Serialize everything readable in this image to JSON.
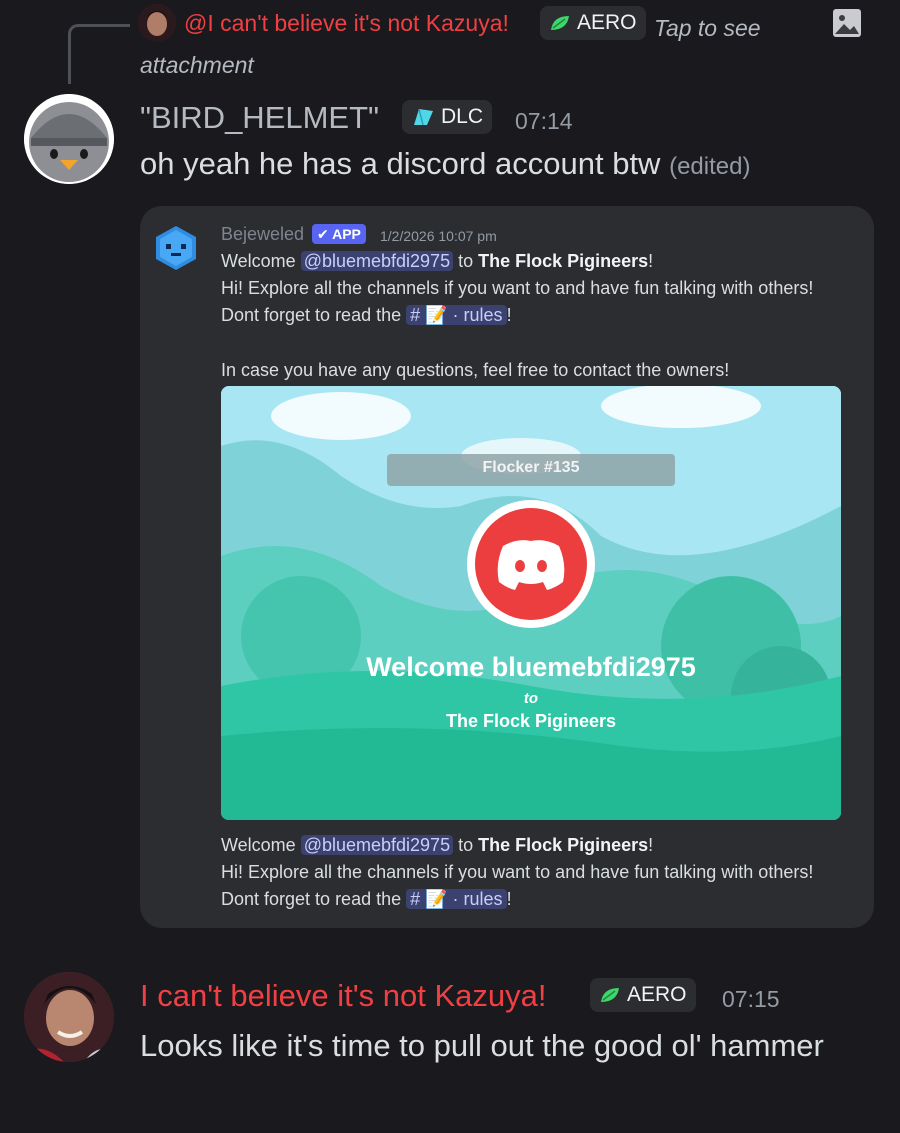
{
  "reply": {
    "author": "@I can't believe it's not Kazuya!",
    "tag": "AERO",
    "text": "Tap to see attachment",
    "icon": "image-icon"
  },
  "message1": {
    "author": "\"BIRD_HELMET\"",
    "tag": "DLC",
    "time": "07:14",
    "text": "oh yeah he has a discord account btw",
    "edited": "(edited)"
  },
  "embed": {
    "bot_name": "Bejeweled",
    "app_badge": "✔ APP",
    "timestamp": "1/2/2026 10:07 pm",
    "line1_pre": "Welcome ",
    "mention": "@bluemebfdi2975",
    "line1_mid": " to ",
    "server": "The Flock Pigineers",
    "line1_end": "!",
    "line2": "Hi! Explore all the channels if you want to and have fun talking with others!",
    "line3_pre": "Dont forget to read the ",
    "channel": "# 📝 · rules",
    "line3_end": "!",
    "line4": "In case you have any questions, feel free to contact the owners!",
    "image": {
      "counter": "Flocker #135",
      "welcome": "Welcome bluemebfdi2975",
      "to": "to",
      "server": "The Flock Pigineers"
    }
  },
  "message2": {
    "author": "I can't believe it's not Kazuya!",
    "tag": "AERO",
    "time": "07:15",
    "text": "Looks like it's time to pull out the good ol' hammer"
  },
  "colors": {
    "background": "#1a1a1e",
    "embed": "#2b2d31",
    "mention_red": "#f23f43",
    "blurple": "#5865f2",
    "discord_red": "#ec3e3e",
    "teal": "#27c5a8"
  }
}
